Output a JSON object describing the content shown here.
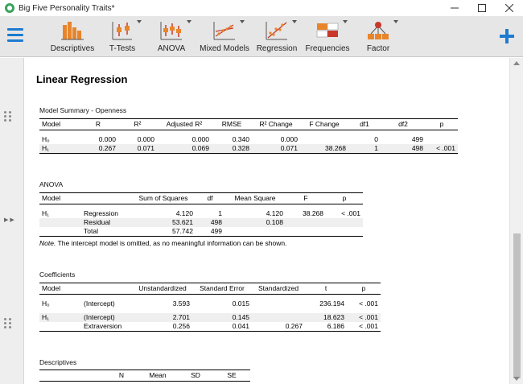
{
  "window": {
    "title": "Big Five Personality Traits*"
  },
  "ribbon": {
    "tools": [
      {
        "label": "Descriptives",
        "icon": "descriptives-icon"
      },
      {
        "label": "T-Tests",
        "icon": "t-tests-icon"
      },
      {
        "label": "ANOVA",
        "icon": "anova-icon"
      },
      {
        "label": "Mixed Models",
        "icon": "mixed-models-icon"
      },
      {
        "label": "Regression",
        "icon": "regression-icon"
      },
      {
        "label": "Frequencies",
        "icon": "frequencies-icon"
      },
      {
        "label": "Factor",
        "icon": "factor-icon"
      }
    ]
  },
  "colors": {
    "accent": "#1e7bd0",
    "bar_orange": "#e8852b",
    "bar_red": "#c8382b"
  },
  "results": {
    "title": "Linear Regression",
    "model_summary": {
      "caption": "Model Summary - Openness",
      "headers": [
        "Model",
        "R",
        "R²",
        "Adjusted R²",
        "RMSE",
        "R² Change",
        "F Change",
        "df1",
        "df2",
        "p"
      ],
      "rows": [
        {
          "model": "H₀",
          "r": "0.000",
          "r2": "0.000",
          "adj": "0.000",
          "rmse": "0.340",
          "r2c": "0.000",
          "fc": "",
          "df1": "0",
          "df2": "499",
          "p": ""
        },
        {
          "model": "H₁",
          "r": "0.267",
          "r2": "0.071",
          "adj": "0.069",
          "rmse": "0.328",
          "r2c": "0.071",
          "fc": "38.268",
          "df1": "1",
          "df2": "498",
          "p": "< .001"
        }
      ]
    },
    "anova": {
      "caption": "ANOVA",
      "headers": [
        "Model",
        "",
        "Sum of Squares",
        "df",
        "Mean Square",
        "F",
        "p"
      ],
      "model": "H₁",
      "rows": [
        {
          "term": "Regression",
          "ss": "4.120",
          "df": "1",
          "ms": "4.120",
          "f": "38.268",
          "p": "< .001"
        },
        {
          "term": "Residual",
          "ss": "53.621",
          "df": "498",
          "ms": "0.108",
          "f": "",
          "p": ""
        },
        {
          "term": "Total",
          "ss": "57.742",
          "df": "499",
          "ms": "",
          "f": "",
          "p": ""
        }
      ],
      "note_label": "Note.",
      "note_text": " The intercept model is omitted, as no meaningful information can be shown."
    },
    "coefficients": {
      "caption": "Coefficients",
      "headers": [
        "Model",
        "",
        "Unstandardized",
        "Standard Error",
        "Standardized",
        "t",
        "p"
      ],
      "rows": [
        {
          "model": "H₀",
          "term": "(Intercept)",
          "unstd": "3.593",
          "se": "0.015",
          "std": "",
          "t": "236.194",
          "p": "< .001"
        },
        {
          "model": "H₁",
          "term": "(Intercept)",
          "unstd": "2.701",
          "se": "0.145",
          "std": "",
          "t": "18.623",
          "p": "< .001"
        },
        {
          "model": "",
          "term": "Extraversion",
          "unstd": "0.256",
          "se": "0.041",
          "std": "0.267",
          "t": "6.186",
          "p": "< .001"
        }
      ]
    },
    "descriptives": {
      "caption": "Descriptives",
      "headers": [
        "",
        "N",
        "Mean",
        "SD",
        "SE"
      ]
    }
  }
}
